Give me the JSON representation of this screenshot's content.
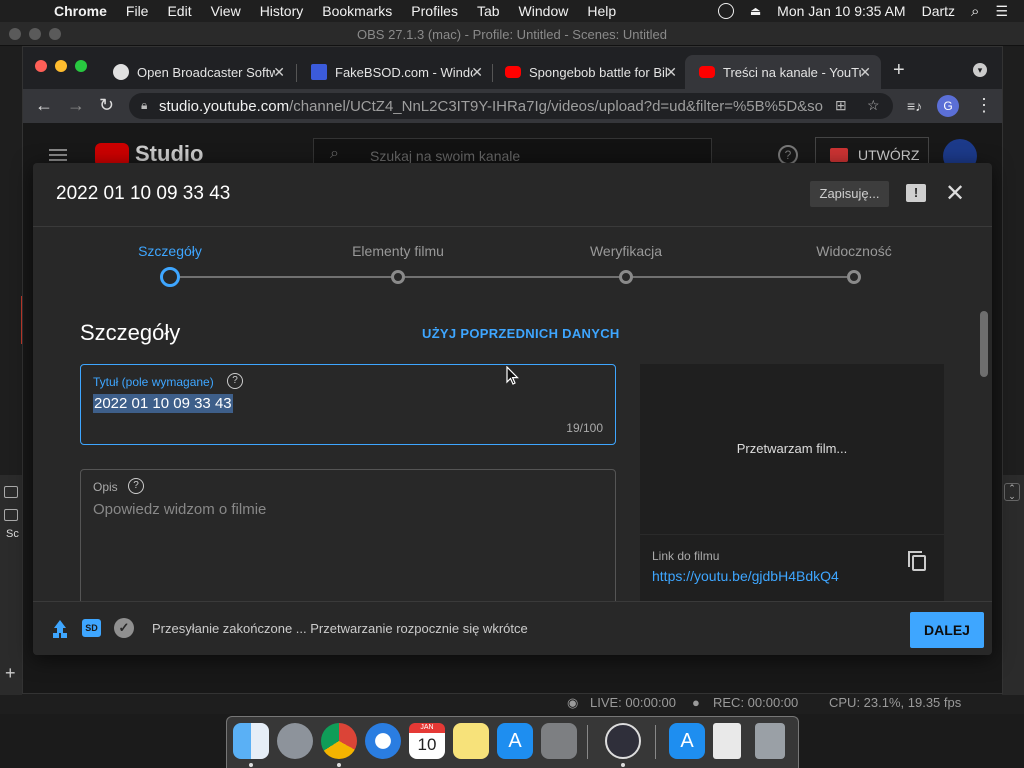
{
  "menubar": {
    "app": "Chrome",
    "items": [
      "File",
      "Edit",
      "View",
      "History",
      "Bookmarks",
      "Profiles",
      "Tab",
      "Window",
      "Help"
    ],
    "clock": "Mon Jan 10  9:35 AM",
    "user": "Dartz",
    "icons": [
      "obs-status-icon",
      "eject-icon",
      "search-icon",
      "control-center-icon"
    ]
  },
  "obs": {
    "window_title": "OBS 27.1.3 (mac) - Profile: Untitled - Scenes: Untitled",
    "scenes_label": "Sc",
    "status": {
      "live": "LIVE: 00:00:00",
      "rec": "REC: 00:00:00",
      "cpu": "CPU: 23.1%, 19.35 fps"
    }
  },
  "browser": {
    "tabs": [
      {
        "label": "Open Broadcaster Software",
        "favicon_color": "#e0e0e0",
        "active": false
      },
      {
        "label": "FakeBSOD.com - Windows",
        "favicon_color": "#3b5bdb",
        "active": false
      },
      {
        "label": "Spongebob battle for Bikini",
        "favicon_color": "#ff0000",
        "active": false
      },
      {
        "label": "Treści na kanale - YouTube",
        "favicon_color": "#ff0000",
        "active": true
      }
    ],
    "url_host": "studio.youtube.com",
    "url_path": "/channel/UCtZ4_NnL2C3IT9Y-IHRa7Ig/videos/upload?d=ud&filter=%5B%5D&so...",
    "avatar_letter": "G"
  },
  "studio": {
    "brand": "Studio",
    "search_placeholder": "Szukaj na swoim kanale",
    "create_label": "UTWÓRZ"
  },
  "modal": {
    "title": "2022 01 10 09 33 43",
    "save_status": "Zapisuję...",
    "steps": [
      "Szczegóły",
      "Elementy filmu",
      "Weryfikacja",
      "Widoczność"
    ],
    "active_step": 0,
    "section_title": "Szczegóły",
    "reuse_label": "UŻYJ POPRZEDNICH DANYCH",
    "title_field": {
      "label": "Tytuł (pole wymagane)",
      "value": "2022 01 10 09 33 43",
      "counter": "19/100"
    },
    "description_field": {
      "label": "Opis",
      "placeholder": "Opowiedz widzom o filmie"
    },
    "preview": {
      "processing": "Przetwarzam film..."
    },
    "link": {
      "label": "Link do filmu",
      "url": "https://youtu.be/gjdbH4BdkQ4"
    },
    "footer": {
      "sd_badge": "SD",
      "message": "Przesyłanie zakończone ... Przetwarzanie rozpocznie się wkrótce",
      "next_label": "DALEJ"
    }
  },
  "dock": {
    "apps": [
      "Finder",
      "Launchpad",
      "Chrome",
      "Safari",
      "Calendar",
      "Notes",
      "App Store",
      "System Preferences",
      "OBS",
      "Downloads",
      "Documents",
      "Trash"
    ],
    "calendar": {
      "month": "JAN",
      "day": "10"
    }
  },
  "colors": {
    "accent": "#3ea6ff",
    "modal_bg": "#282828",
    "youtube_red": "#ff0000"
  }
}
